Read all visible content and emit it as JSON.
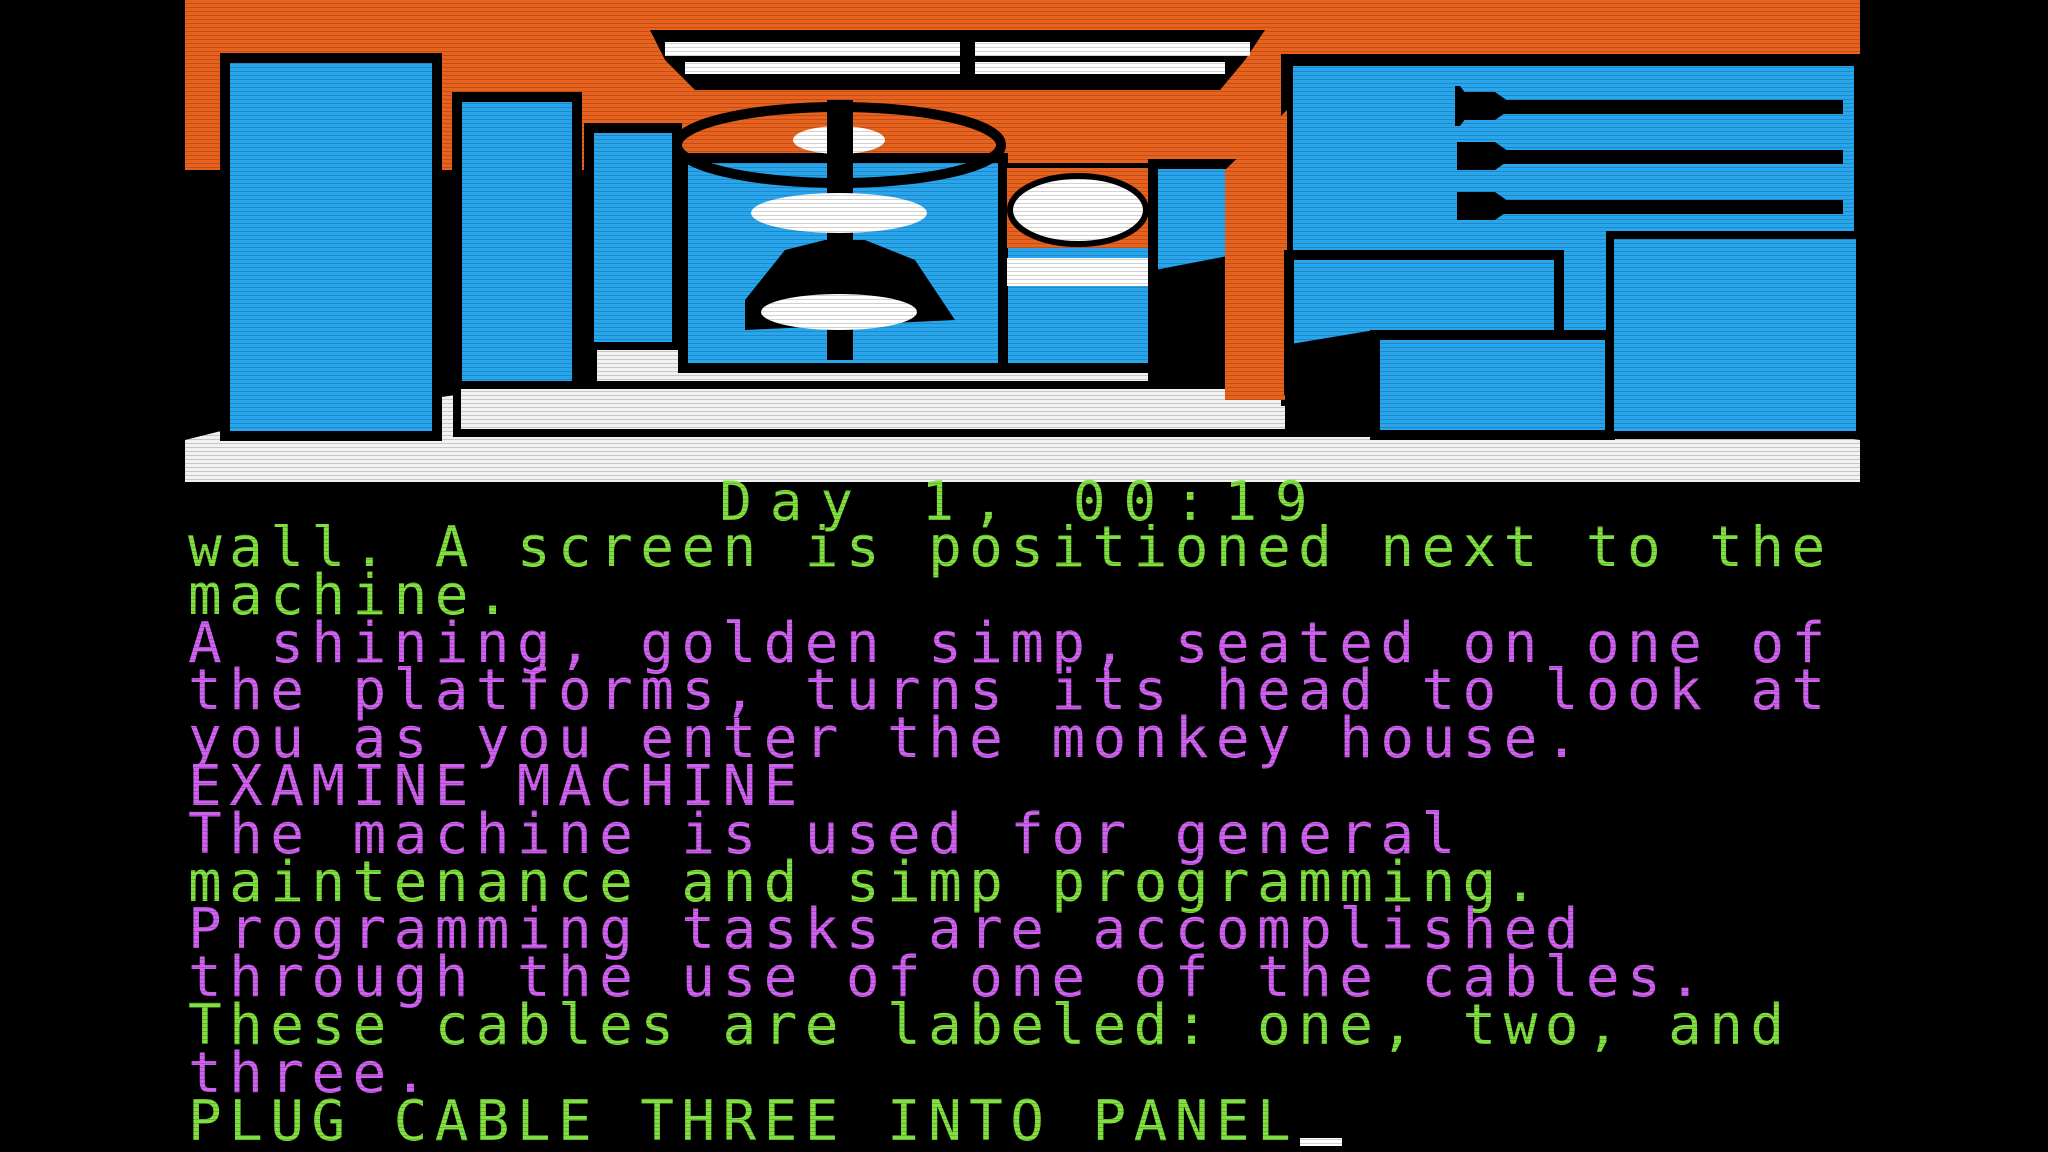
{
  "status": {
    "day_time": "Day 1, 00:19"
  },
  "colors": {
    "ceiling": "#e8621e",
    "wall_blue": "#27a6ee",
    "floor_white": "#f2f2f2",
    "outline": "#000000",
    "text_green": "#7fe040",
    "text_violet": "#d060f0"
  },
  "scene": {
    "icons": [
      "ceiling-light-icon",
      "simp-machine-icon",
      "screen-icon",
      "cable-plug-icon",
      "console-panel-icon"
    ]
  },
  "transcript": [
    "wall. A screen is positioned next to the",
    "machine.",
    "A shining, golden simp, seated on one of",
    "the platforms, turns its head to look at",
    "you as you enter the monkey house.",
    "EXAMINE MACHINE",
    "The machine is used for general",
    "maintenance and simp programming.",
    "Programming tasks are accomplished",
    "through the use of one of the cables.",
    "These cables are labeled: one, two, and",
    "three.",
    "PLUG CABLE THREE INTO PANEL"
  ]
}
